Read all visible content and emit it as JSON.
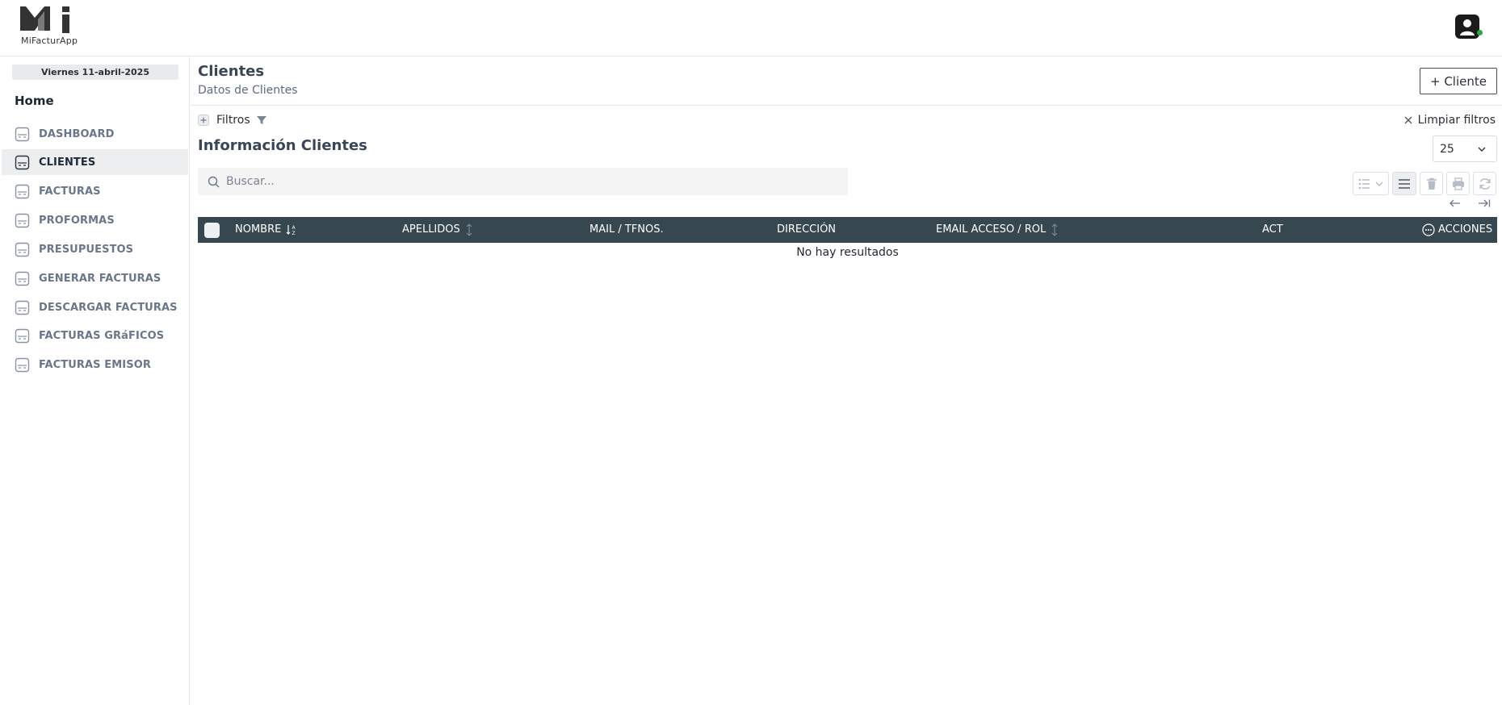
{
  "brand": {
    "logo_text": "MiFacturApp"
  },
  "sidebar": {
    "date": "Viernes 11-abril-2025",
    "home_label": "Home",
    "items": [
      {
        "label": "DASHBOARD",
        "active": false
      },
      {
        "label": "CLIENTES",
        "active": true
      },
      {
        "label": "FACTURAS",
        "active": false
      },
      {
        "label": "PROFORMAS",
        "active": false
      },
      {
        "label": "PRESUPUESTOS",
        "active": false
      },
      {
        "label": "GENERAR FACTURAS",
        "active": false
      },
      {
        "label": "DESCARGAR FACTURAS",
        "active": false
      },
      {
        "label": "FACTURAS GRáFICOS",
        "active": false
      },
      {
        "label": "FACTURAS EMISOR",
        "active": false
      }
    ]
  },
  "header": {
    "title": "Clientes",
    "subtitle": "Datos de Clientes",
    "add_button": "+ Cliente"
  },
  "filters": {
    "label": "Filtros",
    "clear_label": "Limpiar filtros"
  },
  "table_section": {
    "title": "Información Clientes",
    "page_size": "25",
    "search_placeholder": "Buscar...",
    "columns": {
      "nombre": "NOMBRE",
      "apellidos": "APELLIDOS",
      "mail": "MAIL / TFNOS.",
      "direccion": "DIRECCIÓN",
      "email_rol": "EMAIL ACCESO / ROL",
      "act": "ACT",
      "acciones": "ACCIONES"
    },
    "empty_message": "No hay resultados"
  },
  "colors": {
    "header_bg": "#37474f",
    "online_status": "#2aa84a",
    "active_nav_bg": "#eceef0"
  }
}
